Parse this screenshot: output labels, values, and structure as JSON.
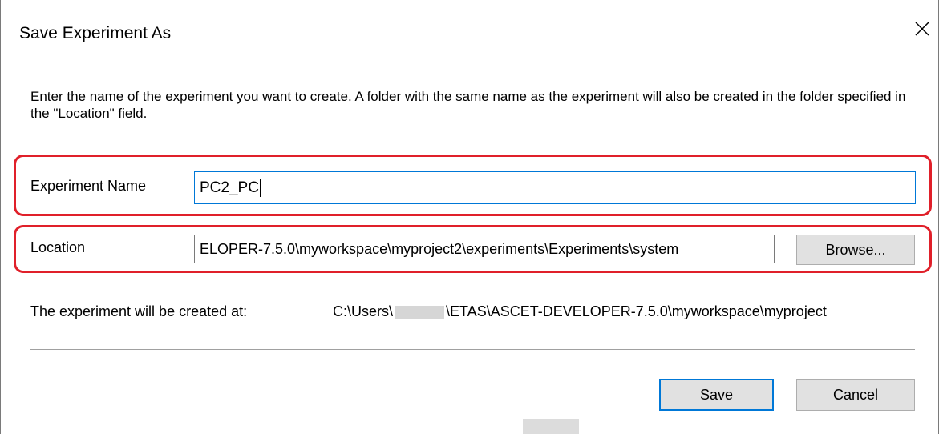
{
  "dialog": {
    "title": "Save Experiment As",
    "instructions": "Enter the name of the experiment you want to create. A folder with the same name as the experiment will also be created in the folder specified in the \"Location\" field."
  },
  "experiment_name": {
    "label": "Experiment Name",
    "value": "PC2_PC"
  },
  "location": {
    "label": "Location",
    "value": "ELOPER-7.5.0\\myworkspace\\myproject2\\experiments\\Experiments\\system",
    "browse_label": "Browse..."
  },
  "created_at": {
    "label": "The experiment will be created at:",
    "path_prefix": "C:\\Users\\",
    "path_suffix": "\\ETAS\\ASCET-DEVELOPER-7.5.0\\myworkspace\\myproject"
  },
  "buttons": {
    "save": "Save",
    "cancel": "Cancel"
  },
  "colors": {
    "highlight": "#e0202a",
    "focus": "#0078d7"
  }
}
